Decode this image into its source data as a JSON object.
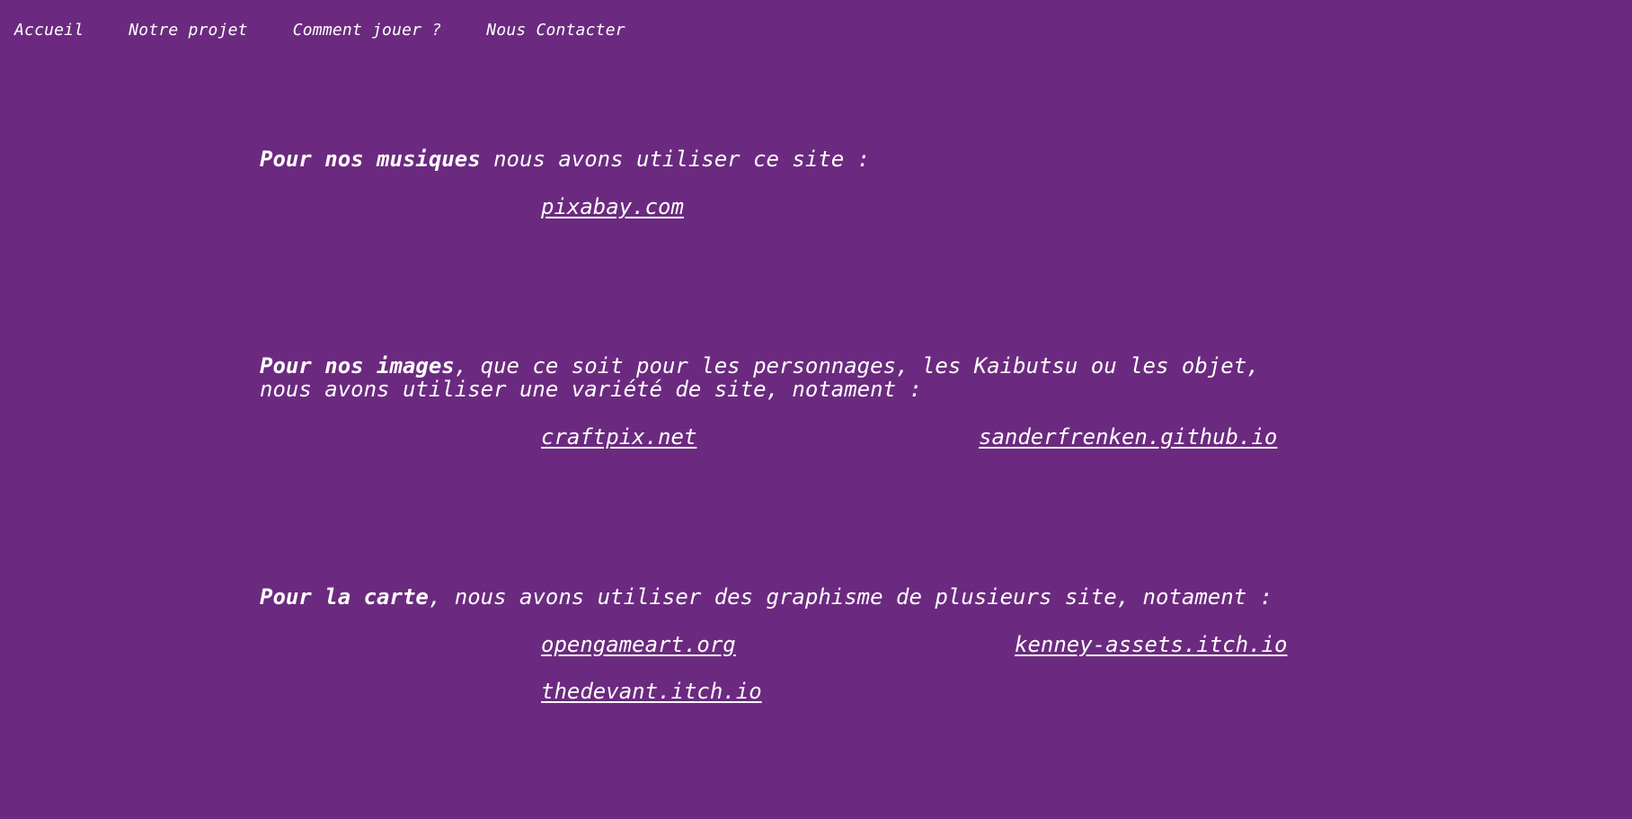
{
  "nav": {
    "items": [
      {
        "label": "Accueil"
      },
      {
        "label": "Notre projet"
      },
      {
        "label": "Comment jouer ?"
      },
      {
        "label": "Nous Contacter"
      }
    ]
  },
  "sections": {
    "musiques": {
      "bold": "Pour nos musiques",
      "text": " nous avons utiliser ce site :",
      "links": [
        "pixabay.com"
      ]
    },
    "images": {
      "bold": "Pour nos images",
      "text": ", que ce soit pour les personnages, les Kaibutsu ou les objet,",
      "text_line2": "nous avons utiliser une variété de site, notament :",
      "links": [
        "craftpix.net",
        "sanderfrenken.github.io"
      ]
    },
    "carte": {
      "bold": "Pour la carte",
      "text": ", nous avons utiliser des graphisme de plusieurs site, notament :",
      "links": [
        "opengameart.org",
        "kenney-assets.itch.io",
        "thedevant.itch.io"
      ]
    }
  },
  "colors": {
    "background": "#6b2a7f",
    "text": "#ffffff"
  }
}
